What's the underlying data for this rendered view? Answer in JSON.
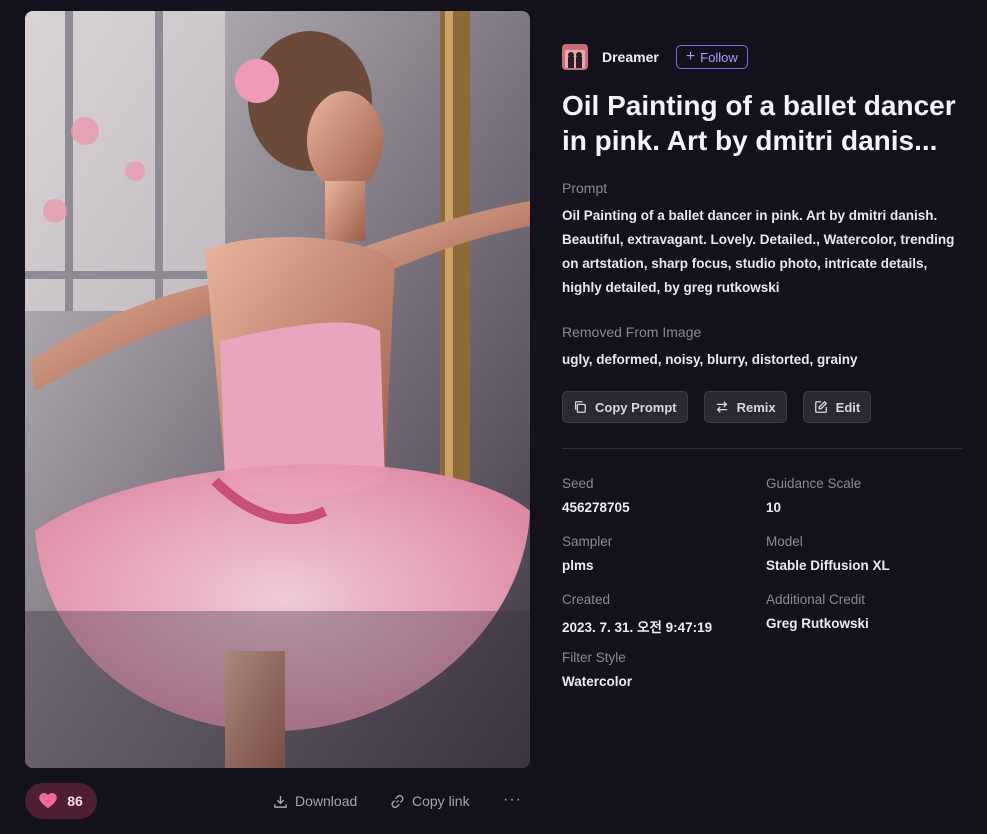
{
  "author": {
    "name": "Dreamer",
    "follow_label": "Follow"
  },
  "title": "Oil Painting of a ballet dancer in pink. Art by dmitri danis...",
  "prompt": {
    "label": "Prompt",
    "text": "Oil Painting of a ballet dancer in pink. Art by dmitri danish. Beautiful, extravagant. Lovely. Detailed., Watercolor, trending on artstation, sharp focus, studio photo, intricate details, highly detailed, by greg rutkowski"
  },
  "removed": {
    "label": "Removed From Image",
    "text": "ugly, deformed, noisy, blurry, distorted, grainy"
  },
  "actions": {
    "copy_prompt": "Copy Prompt",
    "remix": "Remix",
    "edit": "Edit"
  },
  "meta": {
    "seed": {
      "label": "Seed",
      "value": "456278705"
    },
    "guidance": {
      "label": "Guidance Scale",
      "value": "10"
    },
    "sampler": {
      "label": "Sampler",
      "value": "plms"
    },
    "model": {
      "label": "Model",
      "value": "Stable Diffusion XL"
    },
    "created": {
      "label": "Created",
      "value": "2023. 7. 31. 오전 9:47:19"
    },
    "credit": {
      "label": "Additional Credit",
      "value": "Greg Rutkowski"
    },
    "filter": {
      "label": "Filter Style",
      "value": "Watercolor"
    }
  },
  "footer": {
    "likes": "86",
    "download": "Download",
    "copy_link": "Copy link",
    "more": "···"
  },
  "colors": {
    "accent": "#7c69e6",
    "background": "#12111c",
    "like_bg": "#4e1f33",
    "heart": "#f06a95"
  }
}
